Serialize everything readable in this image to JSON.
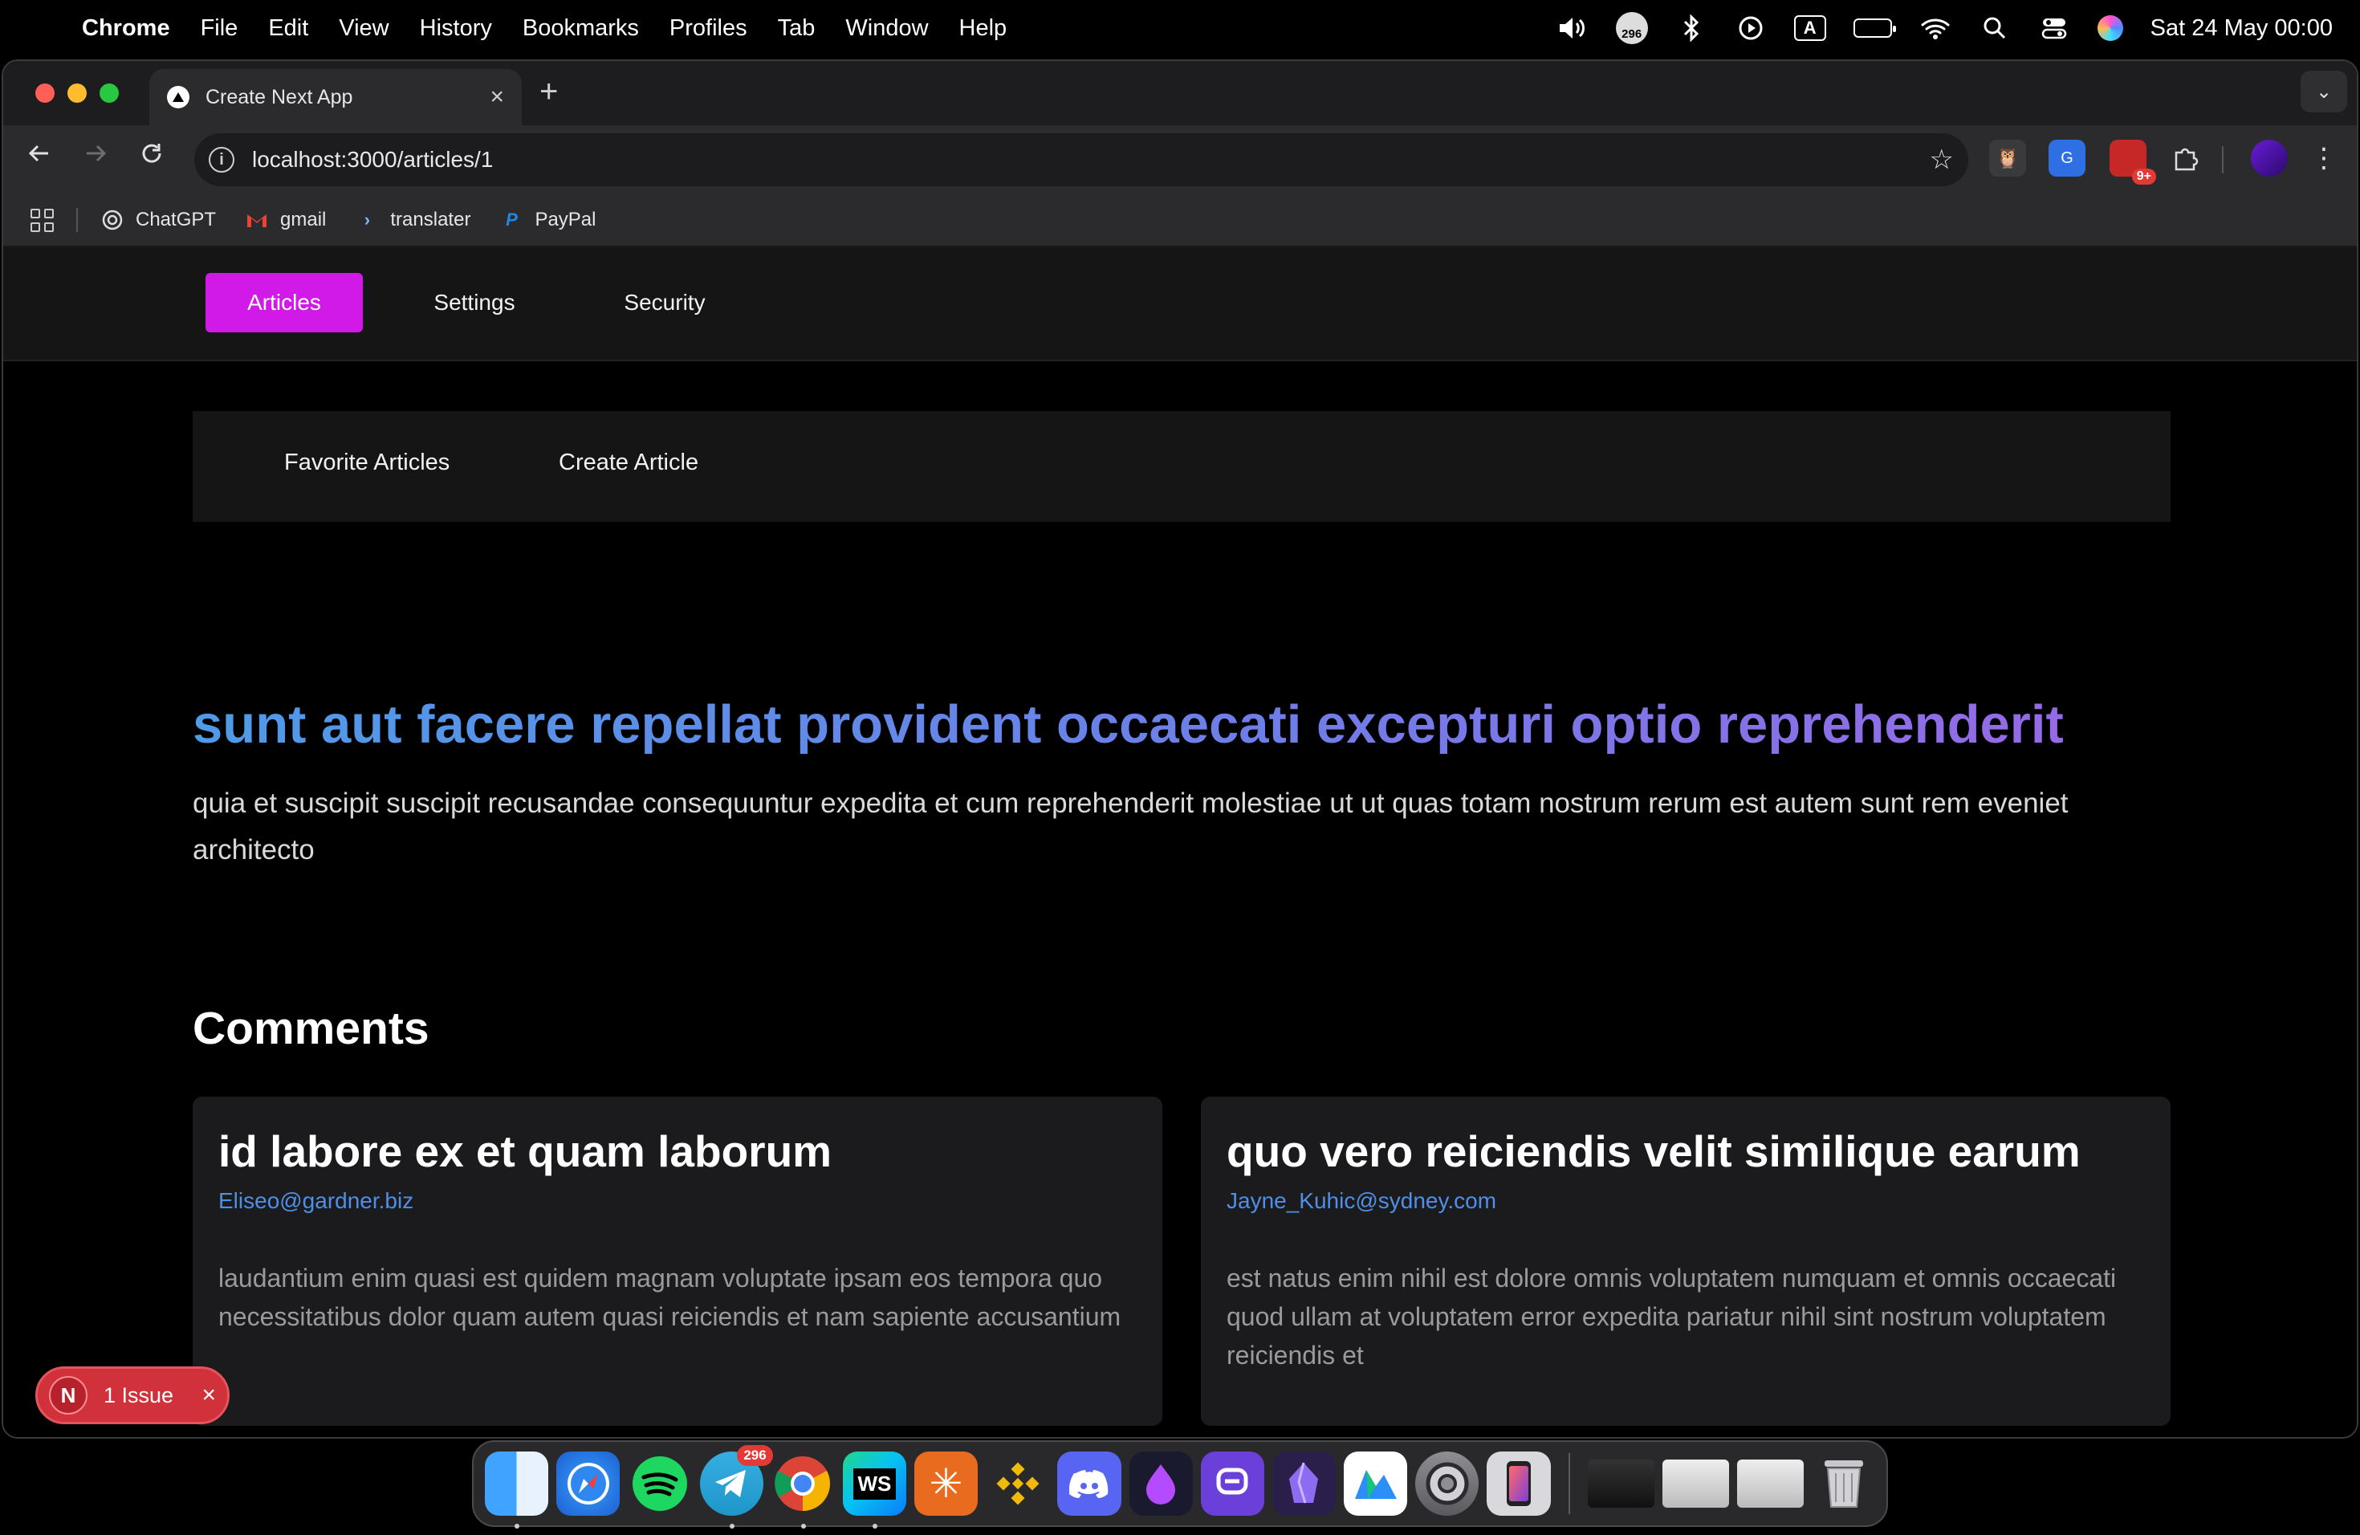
{
  "menubar": {
    "app_name": "Chrome",
    "items": [
      "File",
      "Edit",
      "View",
      "History",
      "Bookmarks",
      "Profiles",
      "Tab",
      "Window",
      "Help"
    ],
    "status_badge": "296",
    "keyboard_label": "A",
    "datetime": "Sat 24 May  00:00"
  },
  "browser": {
    "tab_title": "Create Next App",
    "url": "localhost:3000/articles/1",
    "extension_badge": "9+",
    "bookmarks": [
      {
        "label": "ChatGPT",
        "icon": "chatgpt-icon"
      },
      {
        "label": "gmail",
        "icon": "gmail-icon"
      },
      {
        "label": "translater",
        "icon": "translate-icon"
      },
      {
        "label": "PayPal",
        "icon": "paypal-icon"
      }
    ]
  },
  "page": {
    "nav": {
      "articles": "Articles",
      "settings": "Settings",
      "security": "Security",
      "active_color": "#d11ae8"
    },
    "subnav": {
      "favorites": "Favorite Articles",
      "create": "Create Article"
    },
    "article": {
      "title": "sunt aut facere repellat provident occaecati excepturi optio reprehenderit",
      "body": "quia et suscipit suscipit recusandae consequuntur expedita et cum reprehenderit molestiae ut ut quas totam nostrum rerum est autem sunt rem eveniet architecto"
    },
    "comments_heading": "Comments",
    "comments": [
      {
        "name": "id labore ex et quam laborum",
        "email": "Eliseo@gardner.biz",
        "body": "laudantium enim quasi est quidem magnam voluptate ipsam eos tempora quo necessitatibus dolor quam autem quasi reiciendis et nam sapiente accusantium"
      },
      {
        "name": "quo vero reiciendis velit similique earum",
        "email": "Jayne_Kuhic@sydney.com",
        "body": "est natus enim nihil est dolore omnis voluptatem numquam et omnis occaecati quod ullam at voluptatem error expedita pariatur nihil sint nostrum voluptatem reiciendis et"
      }
    ],
    "issue_indicator": {
      "logo_letter": "N",
      "label": "1 Issue"
    }
  },
  "dock": {
    "telegram_badge": "296",
    "webstorm_label": "WS"
  }
}
